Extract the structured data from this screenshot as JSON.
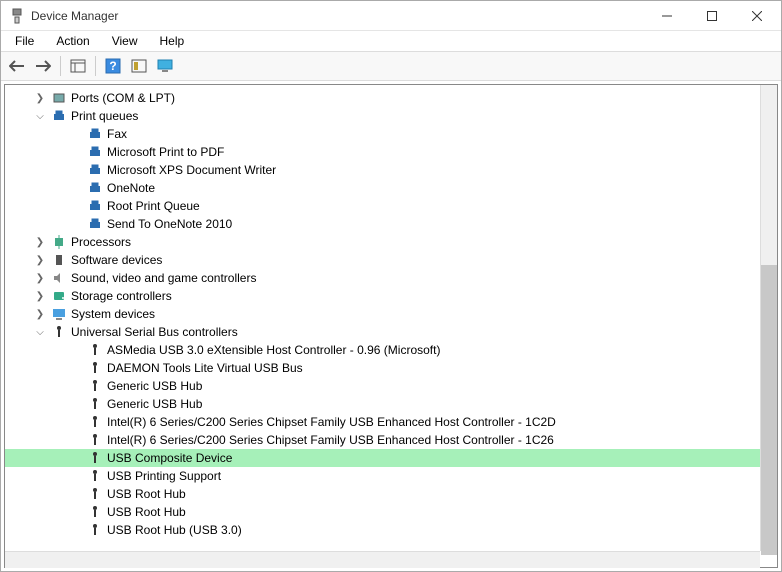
{
  "window": {
    "title": "Device Manager"
  },
  "menu": {
    "file": "File",
    "action": "Action",
    "view": "View",
    "help": "Help"
  },
  "tree": {
    "ports": {
      "label": "Ports (COM & LPT)"
    },
    "print_queues": {
      "label": "Print queues",
      "items": {
        "fax": "Fax",
        "ms_pdf": "Microsoft Print to PDF",
        "ms_xps": "Microsoft XPS Document Writer",
        "onenote": "OneNote",
        "root": "Root Print Queue",
        "send_onenote": "Send To OneNote 2010"
      }
    },
    "processors": {
      "label": "Processors"
    },
    "software_devices": {
      "label": "Software devices"
    },
    "sound": {
      "label": "Sound, video and game controllers"
    },
    "storage": {
      "label": "Storage controllers"
    },
    "system": {
      "label": "System devices"
    },
    "usb": {
      "label": "Universal Serial Bus controllers",
      "items": {
        "asmedia": "ASMedia USB 3.0 eXtensible Host Controller - 0.96 (Microsoft)",
        "daemon": "DAEMON Tools Lite Virtual USB Bus",
        "hub1": "Generic USB Hub",
        "hub2": "Generic USB Hub",
        "intel1": "Intel(R) 6 Series/C200 Series Chipset Family USB Enhanced Host Controller - 1C2D",
        "intel2": "Intel(R) 6 Series/C200 Series Chipset Family USB Enhanced Host Controller - 1C26",
        "composite": "USB Composite Device",
        "printing": "USB Printing Support",
        "root1": "USB Root Hub",
        "root2": "USB Root Hub",
        "root3": "USB Root Hub (USB 3.0)"
      }
    }
  }
}
